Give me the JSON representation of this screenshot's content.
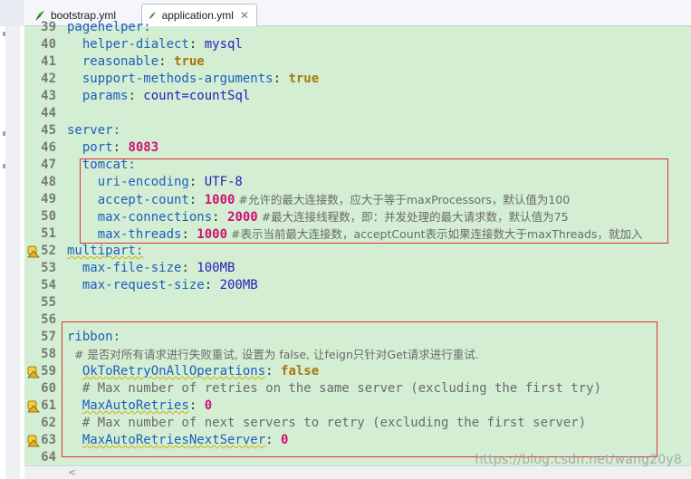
{
  "tabs": [
    {
      "label": "bootstrap.yml",
      "active": false
    },
    {
      "label": "application.yml",
      "active": true,
      "close_glyph": "✕"
    }
  ],
  "colors": {
    "editor_bg": "#d4eed3",
    "key": "#1c5fbd",
    "number": "#d01073",
    "boolean": "#a5780c",
    "comment": "#6a6a6a",
    "highlight_box": "#e03030"
  },
  "editor": {
    "lines": [
      {
        "num": "39",
        "parts": [
          {
            "t": "pagehelper:",
            "c": "key"
          }
        ]
      },
      {
        "num": "40",
        "parts": [
          {
            "t": "  helper-dialect",
            "c": "key"
          },
          {
            "t": ": ",
            "c": "plain"
          },
          {
            "t": "mysql",
            "c": "str"
          }
        ]
      },
      {
        "num": "41",
        "parts": [
          {
            "t": "  reasonable",
            "c": "key"
          },
          {
            "t": ": ",
            "c": "plain"
          },
          {
            "t": "true",
            "c": "bool"
          }
        ]
      },
      {
        "num": "42",
        "parts": [
          {
            "t": "  support-methods-arguments",
            "c": "key"
          },
          {
            "t": ": ",
            "c": "plain"
          },
          {
            "t": "true",
            "c": "bool"
          }
        ]
      },
      {
        "num": "43",
        "parts": [
          {
            "t": "  params",
            "c": "key"
          },
          {
            "t": ": ",
            "c": "plain"
          },
          {
            "t": "count=countSql",
            "c": "str"
          }
        ]
      },
      {
        "num": "44",
        "parts": []
      },
      {
        "num": "45",
        "parts": [
          {
            "t": "server:",
            "c": "key"
          }
        ]
      },
      {
        "num": "46",
        "parts": [
          {
            "t": "  port",
            "c": "key"
          },
          {
            "t": ": ",
            "c": "plain"
          },
          {
            "t": "8083",
            "c": "num"
          }
        ]
      },
      {
        "num": "47",
        "parts": [
          {
            "t": "  tomcat:",
            "c": "key"
          }
        ]
      },
      {
        "num": "48",
        "parts": [
          {
            "t": "    uri-encoding",
            "c": "key"
          },
          {
            "t": ": ",
            "c": "plain"
          },
          {
            "t": "UTF-8",
            "c": "str"
          }
        ]
      },
      {
        "num": "49",
        "parts": [
          {
            "t": "    accept-count",
            "c": "key"
          },
          {
            "t": ": ",
            "c": "plain"
          },
          {
            "t": "1000",
            "c": "num"
          },
          {
            "t": " #允许的最大连接数，应大于等于maxProcessors，默认值为100",
            "c": "cmt-cn"
          }
        ]
      },
      {
        "num": "50",
        "parts": [
          {
            "t": "    max-connections",
            "c": "key"
          },
          {
            "t": ": ",
            "c": "plain"
          },
          {
            "t": "2000",
            "c": "num"
          },
          {
            "t": " #最大连接线程数，即：并发处理的最大请求数，默认值为75",
            "c": "cmt-cn"
          }
        ]
      },
      {
        "num": "51",
        "parts": [
          {
            "t": "    max-threads",
            "c": "key"
          },
          {
            "t": ": ",
            "c": "plain"
          },
          {
            "t": "1000",
            "c": "num"
          },
          {
            "t": " #表示当前最大连接数，acceptCount表示如果连接数大于maxThreads，就加入",
            "c": "cmt-cn"
          }
        ]
      },
      {
        "num": "52",
        "marker": true,
        "parts": [
          {
            "t": "multipart:",
            "c": "key squiggle"
          }
        ]
      },
      {
        "num": "53",
        "parts": [
          {
            "t": "  max-file-size",
            "c": "key"
          },
          {
            "t": ": ",
            "c": "plain"
          },
          {
            "t": "100MB",
            "c": "str"
          }
        ]
      },
      {
        "num": "54",
        "parts": [
          {
            "t": "  max-request-size",
            "c": "key"
          },
          {
            "t": ": ",
            "c": "plain"
          },
          {
            "t": "200MB",
            "c": "str"
          }
        ]
      },
      {
        "num": "55",
        "parts": []
      },
      {
        "num": "56",
        "parts": []
      },
      {
        "num": "57",
        "parts": [
          {
            "t": "ribbon:",
            "c": "key"
          }
        ]
      },
      {
        "num": "58",
        "parts": [
          {
            "t": "  # 是否对所有请求进行失败重试, 设置为 false, 让feign只针对Get请求进行重试.",
            "c": "cmt-cn"
          }
        ]
      },
      {
        "num": "59",
        "marker": true,
        "parts": [
          {
            "t": "  ",
            "c": "plain"
          },
          {
            "t": "OkToRetryOnAllOperations",
            "c": "key squiggle"
          },
          {
            "t": ": ",
            "c": "plain"
          },
          {
            "t": "false",
            "c": "bool"
          }
        ]
      },
      {
        "num": "60",
        "parts": [
          {
            "t": "  # Max number of retries on the same server (excluding the first try)",
            "c": "cmt"
          }
        ]
      },
      {
        "num": "61",
        "marker": true,
        "parts": [
          {
            "t": "  ",
            "c": "plain"
          },
          {
            "t": "MaxAutoRetries",
            "c": "key squiggle"
          },
          {
            "t": ": ",
            "c": "plain"
          },
          {
            "t": "0",
            "c": "num"
          }
        ]
      },
      {
        "num": "62",
        "parts": [
          {
            "t": "  # Max number of next servers to retry (excluding the first server)",
            "c": "cmt"
          }
        ]
      },
      {
        "num": "63",
        "marker": true,
        "parts": [
          {
            "t": "  ",
            "c": "plain"
          },
          {
            "t": "MaxAutoRetriesNextServer",
            "c": "key squiggle"
          },
          {
            "t": ": ",
            "c": "plain"
          },
          {
            "t": "0",
            "c": "num"
          }
        ]
      },
      {
        "num": "64",
        "parts": []
      }
    ]
  },
  "scrollbar": {
    "left_glyph": "<"
  },
  "watermark": "https://blog.csdn.net/wang20y8"
}
